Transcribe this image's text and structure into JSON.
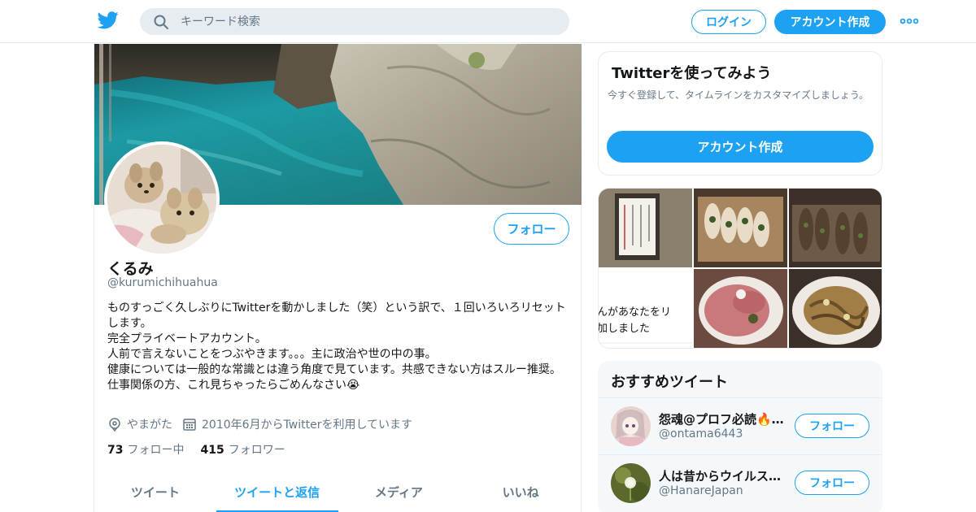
{
  "topbar": {
    "search_placeholder": "キーワード検索",
    "login_label": "ログイン",
    "signup_label": "アカウント作成"
  },
  "profile": {
    "follow_label": "フォロー",
    "name": "くるみ",
    "handle": "@kurumichihuahua",
    "bio_lines": [
      "ものすっごく久しぶりにTwitterを動かしました（笑）という訳で、１回いろいろリセットします。",
      "完全プライベートアカウント。",
      "人前で言えないことをつぶやきます。。。主に政治や世の中の事。",
      "健康については一般的な常識とは違う角度で見ています。共感できない方はスルー推奨。",
      "仕事関係の方、これ見ちゃったらごめんなさい😭"
    ],
    "location": "やまがた",
    "joined": "2010年6月からTwitterを利用しています",
    "following_count": "73",
    "following_label": "フォロー中",
    "followers_count": "415",
    "followers_label": "フォロワー"
  },
  "tabs": [
    {
      "label": "ツイート",
      "active": false
    },
    {
      "label": "ツイートと返信",
      "active": true
    },
    {
      "label": "メディア",
      "active": false
    },
    {
      "label": "いいね",
      "active": false
    }
  ],
  "signup_card": {
    "title": "Twitterを使ってみよう",
    "description": "今すぐ登録して、タイムラインをカスタマイズしましょう。",
    "button_label": "アカウント作成"
  },
  "media": {
    "text_tile_lines": [
      "んがあなたをリ",
      "加しました"
    ]
  },
  "recommended": {
    "title": "おすすめツイート",
    "items": [
      {
        "name": "怨魂@プロフ必読🔥…",
        "handle": "@ontama6443",
        "follow_label": "フォロー"
      },
      {
        "name": "人は昔からウイルス…",
        "handle": "@HanareJapan",
        "follow_label": "フォロー"
      }
    ]
  },
  "colors": {
    "accent": "#1da1f2",
    "text_primary": "#14171a",
    "text_secondary": "#657786",
    "border": "#e6ecf0"
  },
  "icons": [
    "twitter-bird-icon",
    "search-icon",
    "more-dots-icon",
    "location-icon",
    "calendar-icon"
  ]
}
